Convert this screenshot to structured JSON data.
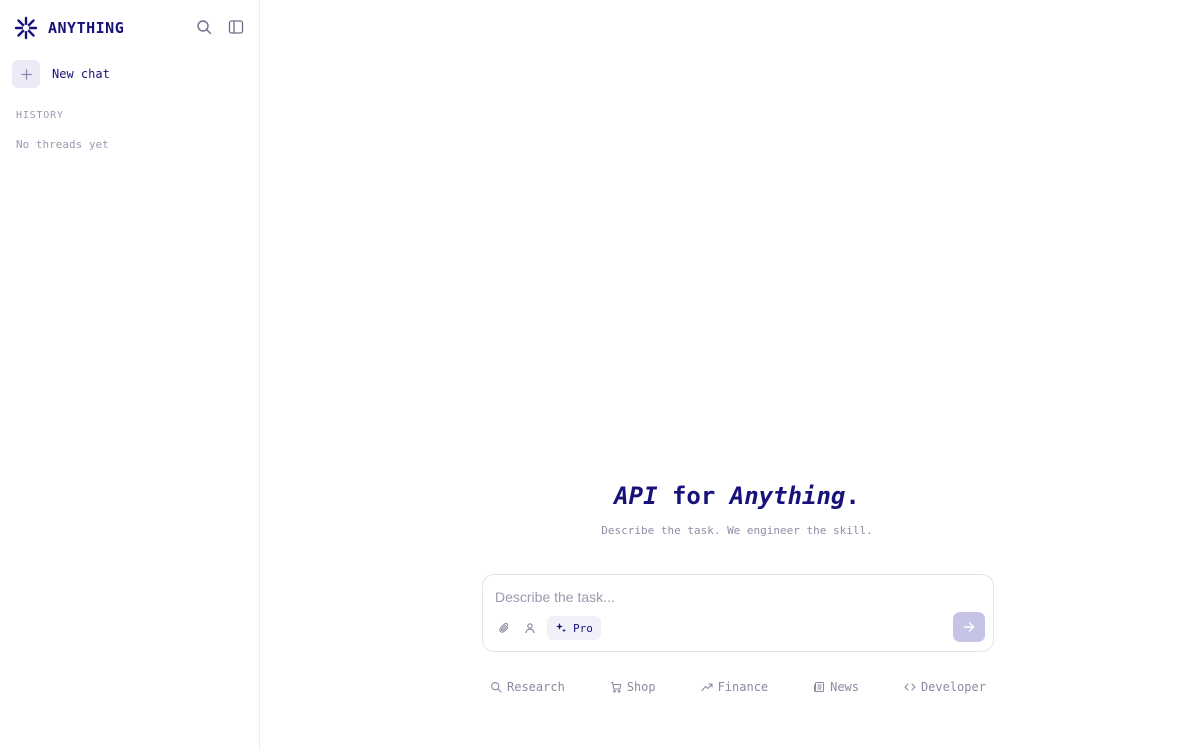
{
  "sidebar": {
    "brand": {
      "name": "ANYTHING",
      "logo_icon": "asterisk-burst-logo"
    },
    "top_icons": [
      "search-icon",
      "sidebar-toggle-icon"
    ],
    "new_chat": {
      "label": "New chat",
      "icon": "plus-icon"
    },
    "history": {
      "heading": "HISTORY",
      "empty_text": "No threads yet"
    }
  },
  "hero": {
    "title_part1": "API",
    "title_part2": " for ",
    "title_part3": "Anything",
    "title_part4": ".",
    "subtitle": "Describe the task. We engineer the skill."
  },
  "composer": {
    "placeholder": "Describe the task...",
    "value": "",
    "tools": [
      "paperclip-icon",
      "person-icon"
    ],
    "mode_chip": {
      "label": "Pro",
      "icon": "sparkle-icon"
    },
    "send_icon": "arrow-right-icon"
  },
  "suggestions": [
    {
      "label": "Research",
      "icon": "search-icon"
    },
    {
      "label": "Shop",
      "icon": "cart-icon"
    },
    {
      "label": "Finance",
      "icon": "trend-up-icon"
    },
    {
      "label": "News",
      "icon": "newspaper-icon"
    },
    {
      "label": "Developer",
      "icon": "code-icon"
    }
  ],
  "colors": {
    "brand": "#17127a",
    "muted": "#9a9ab0",
    "send_button": "#c5c3e6",
    "chip_bg": "#f2f1fa"
  }
}
